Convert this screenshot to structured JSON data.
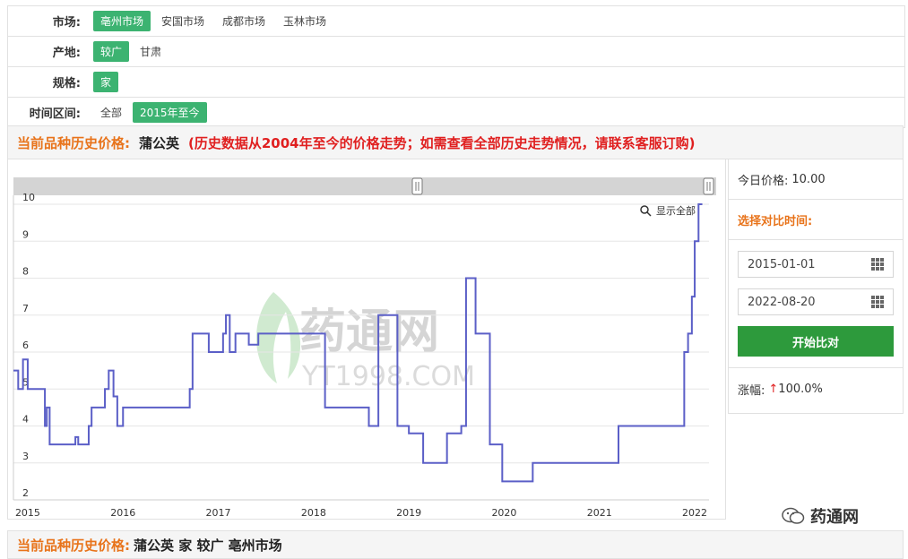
{
  "filters": {
    "market": {
      "label": "市场:",
      "options": [
        "亳州市场",
        "安国市场",
        "成都市场",
        "玉林市场"
      ],
      "active": 0
    },
    "origin": {
      "label": "产地:",
      "options": [
        "较广",
        "甘肃"
      ],
      "active": 0
    },
    "spec": {
      "label": "规格:",
      "options": [
        "家"
      ],
      "active": 0
    },
    "range": {
      "label": "时间区间:",
      "options": [
        "全部",
        "2015年至今"
      ],
      "active": 1
    }
  },
  "title": {
    "label": "当前品种历史价格:",
    "herb": "蒲公英",
    "note": "(历史数据从2004年至今的价格走势；如需查看全部历史走势情况，请联系客服订购)"
  },
  "chart_toolbar": {
    "show_all": "显示全部"
  },
  "watermark": {
    "cn": "药通网",
    "en": "YT1998.COM"
  },
  "side": {
    "today_label": "今日价格:",
    "today_value": "10.00",
    "compare_label": "选择对比时间:",
    "start_date": "2015-01-01",
    "end_date": "2022-08-20",
    "start_button": "开始比对",
    "change_label": "涨幅:",
    "change_value": "100.0%",
    "change_arrow": "↑"
  },
  "bottom": {
    "label": "当前品种历史价格:",
    "info": "蒲公英 家 较广 亳州市场"
  },
  "wechat": {
    "name": "药通网"
  },
  "colors": {
    "accent_green": "#3cb371",
    "line": "#5b5fc7",
    "orange": "#e8731a",
    "red": "#e02020"
  },
  "chart_data": {
    "type": "line",
    "title": "",
    "xlabel": "",
    "ylabel": "",
    "ylim": [
      2,
      10
    ],
    "yticks": [
      2,
      3,
      4,
      5,
      6,
      7,
      8,
      9,
      10
    ],
    "xticks": [
      "2015",
      "2016",
      "2017",
      "2018",
      "2019",
      "2020",
      "2021",
      "2022"
    ],
    "xlim": [
      2014.85,
      2022.15
    ],
    "grid": true,
    "series": [
      {
        "name": "",
        "step": true,
        "x": [
          2014.85,
          2014.9,
          2014.95,
          2015.0,
          2015.15,
          2015.18,
          2015.2,
          2015.23,
          2015.3,
          2015.35,
          2015.5,
          2015.53,
          2015.64,
          2015.67,
          2015.81,
          2015.85,
          2015.9,
          2015.94,
          2015.96,
          2016.0,
          2016.06,
          2016.1,
          2016.7,
          2016.73,
          2016.9,
          2017.05,
          2017.08,
          2017.12,
          2017.18,
          2017.32,
          2017.42,
          2017.6,
          2017.82,
          2018.12,
          2018.3,
          2018.55,
          2018.58,
          2018.68,
          2018.72,
          2018.88,
          2019.0,
          2019.15,
          2019.4,
          2019.55,
          2019.6,
          2019.7,
          2019.85,
          2019.98,
          2020.3,
          2020.55,
          2021.2,
          2021.85,
          2021.89,
          2021.93,
          2021.97,
          2022.0,
          2022.04,
          2022.08
        ],
        "y": [
          5.5,
          5.0,
          5.8,
          5.0,
          5.0,
          4.0,
          4.5,
          3.5,
          3.5,
          3.5,
          3.7,
          3.5,
          4.0,
          4.5,
          5.0,
          5.5,
          4.8,
          4.0,
          4.0,
          4.5,
          4.5,
          4.5,
          5.0,
          6.5,
          6.0,
          6.5,
          7.0,
          6.0,
          6.5,
          6.2,
          6.5,
          6.5,
          6.5,
          4.5,
          4.5,
          4.5,
          4.0,
          7.0,
          7.0,
          4.0,
          3.8,
          3.0,
          3.8,
          4.0,
          8.0,
          6.5,
          3.5,
          2.5,
          3.0,
          3.0,
          4.0,
          4.0,
          6.0,
          6.5,
          7.5,
          9.0,
          10.0,
          10.0
        ]
      }
    ]
  }
}
